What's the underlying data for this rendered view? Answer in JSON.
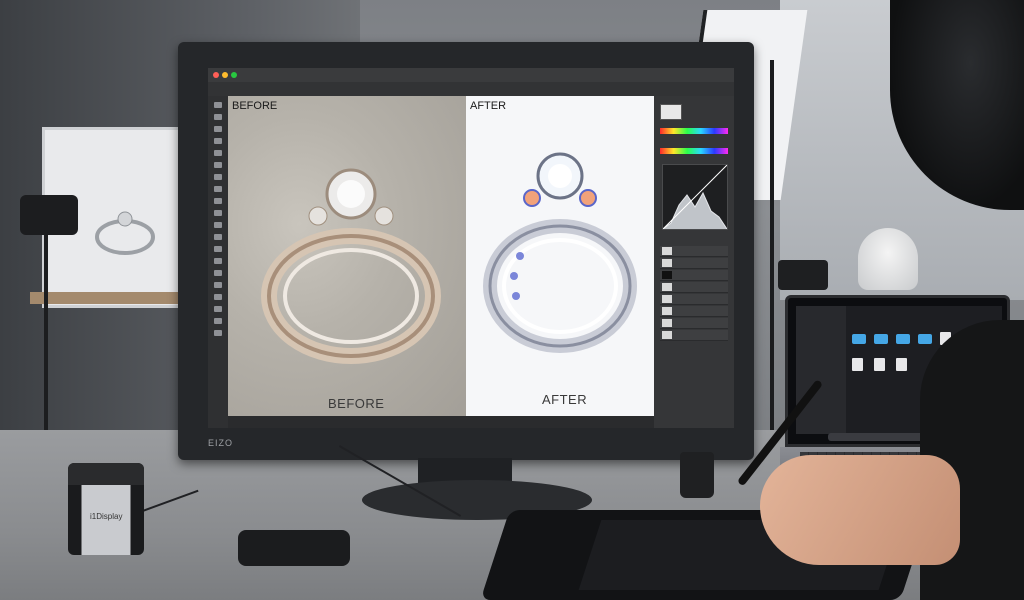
{
  "canvas": {
    "before_label_top": "BEFORE",
    "before_label_bottom": "BEFORE",
    "after_label_top": "AFTER",
    "after_label_bottom": "AFTER"
  },
  "monitor": {
    "brand": "EIZO"
  },
  "calibrator": {
    "brand": "i1Display"
  },
  "colors": {
    "ps_dark": "#2b2c2e",
    "ps_panel": "#353638",
    "canvas_after_bg": "#f6f7f9",
    "finder_folder": "#45a7e6"
  },
  "icons": {
    "toolbar": "photoshop-tools-icon",
    "histogram": "histogram-icon",
    "folder": "folder-icon",
    "file": "document-icon"
  }
}
